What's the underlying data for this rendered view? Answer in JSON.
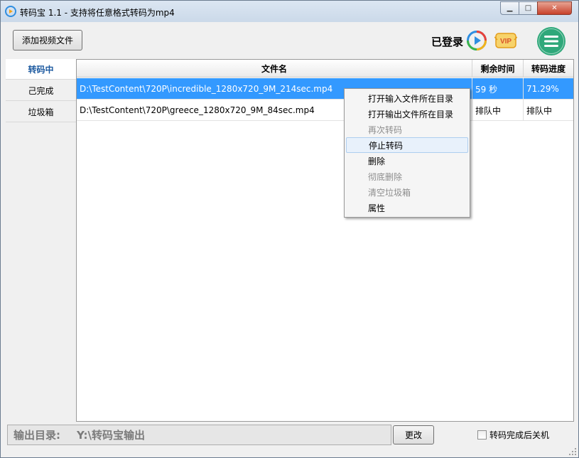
{
  "window": {
    "title": "转码宝 1.1 - 支持将任意格式转码为mp4",
    "controls": {
      "minimize": "▁",
      "maximize": "□",
      "close": "✕"
    }
  },
  "toolbar": {
    "add_button": "添加视频文件",
    "login_status": "已登录",
    "vip_badge": "VIP"
  },
  "sidebar": {
    "items": [
      {
        "label": "转码中",
        "active": true
      },
      {
        "label": "己完成",
        "active": false
      },
      {
        "label": "垃圾箱",
        "active": false
      }
    ]
  },
  "table": {
    "columns": [
      "文件名",
      "剩余时间",
      "转码进度"
    ],
    "rows": [
      {
        "file": "D:\\TestContent\\720P\\incredible_1280x720_9M_214sec.mp4",
        "remaining": "59 秒",
        "progress": "71.29%",
        "selected": true
      },
      {
        "file": "D:\\TestContent\\720P\\greece_1280x720_9M_84sec.mp4",
        "remaining": "排队中",
        "progress": "排队中",
        "selected": false
      }
    ]
  },
  "context_menu": {
    "items": [
      {
        "label": "打开输入文件所在目录",
        "enabled": true
      },
      {
        "label": "打开输出文件所在目录",
        "enabled": true
      },
      {
        "label": "再次转码",
        "enabled": false
      },
      {
        "label": "停止转码",
        "enabled": true,
        "hovered": true
      },
      {
        "label": "删除",
        "enabled": true
      },
      {
        "label": "彻底删除",
        "enabled": false
      },
      {
        "label": "清空垃圾箱",
        "enabled": false
      },
      {
        "label": "属性",
        "enabled": true
      }
    ]
  },
  "footer": {
    "output_label": "输出目录:",
    "output_path": "Y:\\转码宝输出",
    "change_button": "更改",
    "shutdown_checkbox": "转码完成后关机",
    "shutdown_checked": false
  },
  "colors": {
    "selection": "#3399ff",
    "active_tab_text": "#1d5aa0",
    "menu_icon_green": "#2fa87a",
    "vip_gold": "#f0b43a"
  }
}
